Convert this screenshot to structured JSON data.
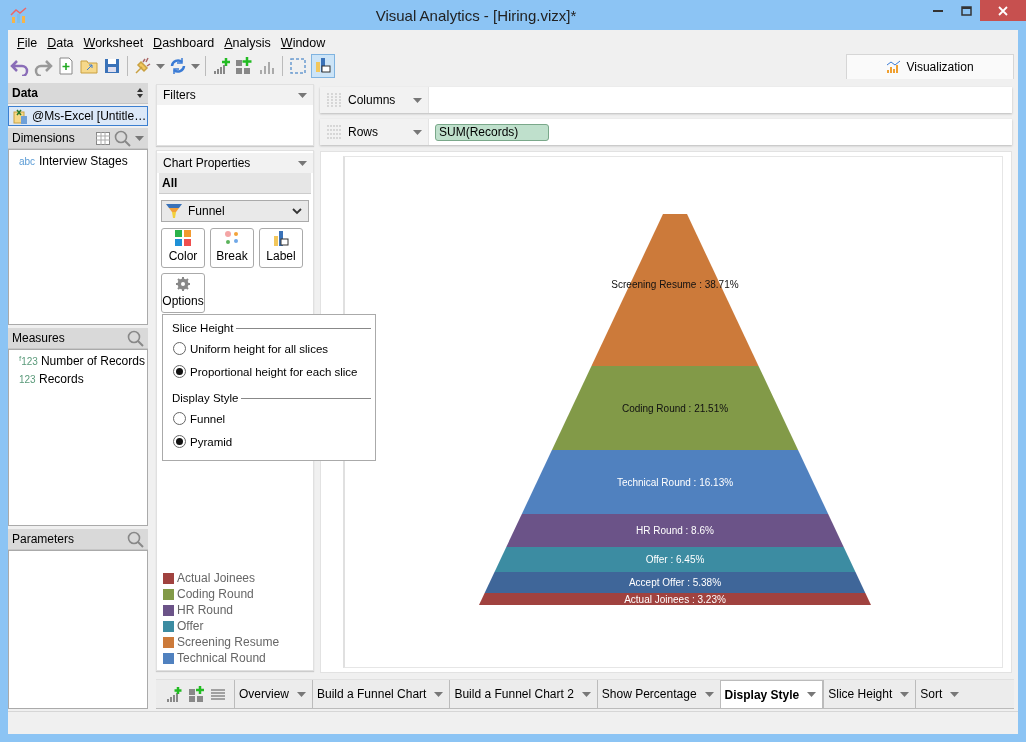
{
  "window": {
    "title": "Visual Analytics - [Hiring.vizx]*"
  },
  "menu": [
    {
      "label": "File"
    },
    {
      "label": "Data"
    },
    {
      "label": "Worksheet"
    },
    {
      "label": "Dashboard"
    },
    {
      "label": "Analysis"
    },
    {
      "label": "Window"
    }
  ],
  "visualization_tab": {
    "label": "Visualization"
  },
  "data_panel": {
    "title": "Data",
    "source": "@Ms-Excel [Untitle…",
    "dimensions": {
      "title": "Dimensions",
      "items": [
        {
          "badge": "abc",
          "label": "Interview Stages"
        }
      ]
    },
    "measures": {
      "title": "Measures",
      "items": [
        {
          "badge": "$^{f}$123",
          "label": "Number of Records"
        },
        {
          "badge": "123",
          "label": "Records"
        }
      ]
    },
    "parameters": {
      "title": "Parameters"
    }
  },
  "filters": {
    "title": "Filters"
  },
  "chart_properties": {
    "title": "Chart Properties",
    "scope": "All",
    "chart_type": "Funnel",
    "buttons": [
      {
        "kind": "color",
        "label": "Color"
      },
      {
        "kind": "break",
        "label": "Break"
      },
      {
        "kind": "label",
        "label": "Label"
      },
      {
        "kind": "options",
        "label": "Options"
      }
    ],
    "options_popup": {
      "groups": [
        {
          "title": "Slice Height",
          "options": [
            {
              "label": "Uniform height for all slices",
              "selected": false
            },
            {
              "label": "Proportional height for each slice",
              "selected": true
            }
          ]
        },
        {
          "title": "Display Style",
          "options": [
            {
              "label": "Funnel",
              "selected": false
            },
            {
              "label": "Pyramid",
              "selected": true
            }
          ]
        }
      ]
    },
    "legend": [
      {
        "label": "Actual Joinees",
        "color": "#a0423f"
      },
      {
        "label": "Coding Round",
        "color": "#829a48"
      },
      {
        "label": "HR Round",
        "color": "#6b5388"
      },
      {
        "label": "Offer",
        "color": "#3c8ca2"
      },
      {
        "label": "Screening Resume",
        "color": "#cc7a3a"
      },
      {
        "label": "Technical Round",
        "color": "#5081bf"
      }
    ]
  },
  "shelves": [
    {
      "label": "Columns"
    },
    {
      "label": "Rows",
      "pills": [
        "SUM(Records)"
      ]
    }
  ],
  "chart": {
    "slices": [
      {
        "label": "Screening Resume : 38.71%",
        "color": "#cc7a3a"
      },
      {
        "label": "Coding Round : 21.51%",
        "color": "#829a48"
      },
      {
        "label": "Technical Round : 16.13%",
        "color": "#5081bf"
      },
      {
        "label": "HR Round : 8.6%",
        "color": "#6b5388"
      },
      {
        "label": "Offer : 6.45%",
        "color": "#3c8ca2"
      },
      {
        "label": "Accept Offer : 5.38%",
        "color": "#3f6699"
      },
      {
        "label": "Actual Joinees : 3.23%",
        "color": "#a0423f"
      }
    ]
  },
  "sheet_tabs": [
    {
      "label": "Overview",
      "selected": false
    },
    {
      "label": "Build a Funnel Chart",
      "selected": false
    },
    {
      "label": "Build a Funnel Chart 2",
      "selected": false
    },
    {
      "label": "Show Percentage",
      "selected": false
    },
    {
      "label": "Display Style",
      "selected": true
    },
    {
      "label": "Slice Height",
      "selected": false
    },
    {
      "label": "Sort",
      "selected": false
    }
  ]
}
